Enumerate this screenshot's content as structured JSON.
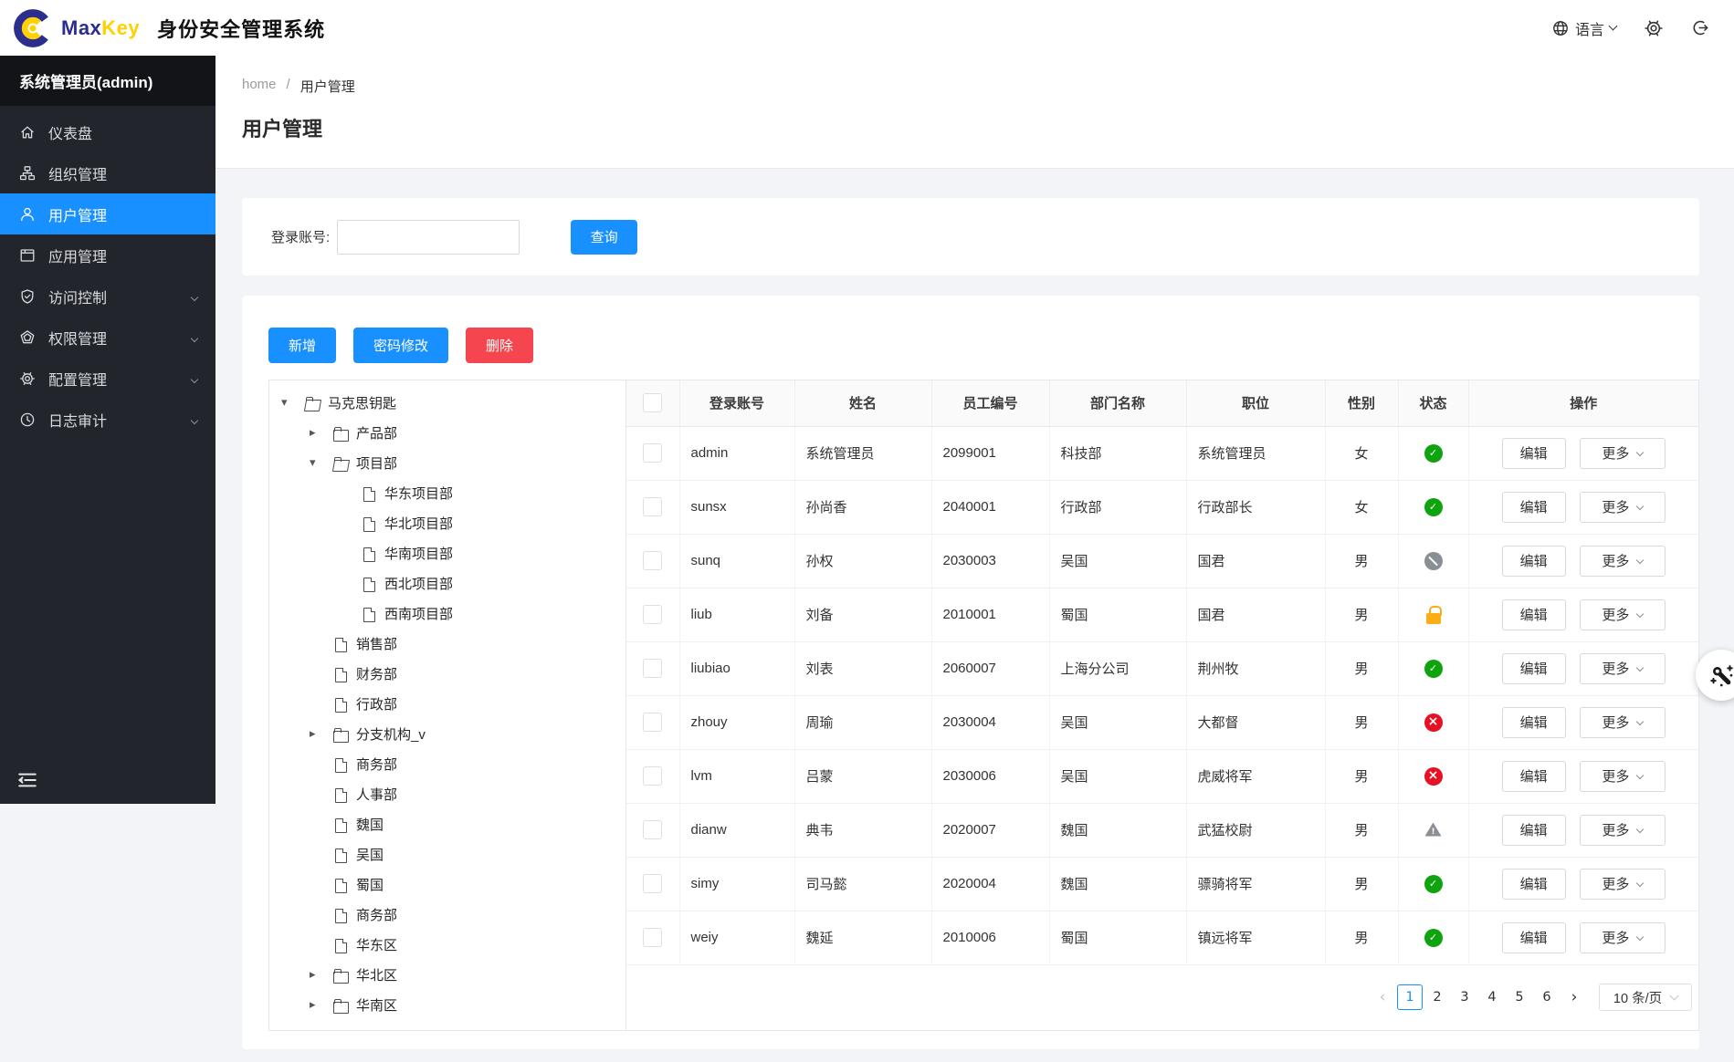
{
  "brand": {
    "name_primary": "Max",
    "name_secondary": "Key",
    "product": "身份安全管理系统"
  },
  "topbar": {
    "language": "语言"
  },
  "sidebar": {
    "user": "系统管理员(admin)",
    "items": [
      {
        "label": "仪表盘",
        "icon": "home-icon"
      },
      {
        "label": "组织管理",
        "icon": "org-icon"
      },
      {
        "label": "用户管理",
        "icon": "user-icon",
        "active": true
      },
      {
        "label": "应用管理",
        "icon": "app-icon"
      },
      {
        "label": "访问控制",
        "icon": "shield-icon",
        "expandable": true
      },
      {
        "label": "权限管理",
        "icon": "gem-icon",
        "expandable": true
      },
      {
        "label": "配置管理",
        "icon": "gear-icon",
        "expandable": true
      },
      {
        "label": "日志审计",
        "icon": "clock-icon",
        "expandable": true
      }
    ]
  },
  "breadcrumb": {
    "home": "home",
    "separator": "/",
    "current": "用户管理"
  },
  "page": {
    "title": "用户管理"
  },
  "search": {
    "label": "登录账号:",
    "value": "",
    "button": "查询"
  },
  "toolbar": {
    "add": "新增",
    "change_password": "密码修改",
    "delete": "删除"
  },
  "tree": {
    "nodes": [
      {
        "label": "马克思钥匙",
        "level": "lvl0",
        "caret": "caret-down",
        "icon": "folder-open"
      },
      {
        "label": "产品部",
        "level": "lvl1",
        "caret": "caret-right",
        "icon": "folder-closed"
      },
      {
        "label": "项目部",
        "level": "lvl1",
        "caret": "caret-down",
        "icon": "folder-open"
      },
      {
        "label": "华东项目部",
        "level": "lvl2",
        "caret": "caret-none",
        "icon": "file"
      },
      {
        "label": "华北项目部",
        "level": "lvl2",
        "caret": "caret-none",
        "icon": "file"
      },
      {
        "label": "华南项目部",
        "level": "lvl2",
        "caret": "caret-none",
        "icon": "file"
      },
      {
        "label": "西北项目部",
        "level": "lvl2",
        "caret": "caret-none",
        "icon": "file"
      },
      {
        "label": "西南项目部",
        "level": "lvl2",
        "caret": "caret-none",
        "icon": "file"
      },
      {
        "label": "销售部",
        "level": "lvl1",
        "caret": "caret-none",
        "icon": "file"
      },
      {
        "label": "财务部",
        "level": "lvl1",
        "caret": "caret-none",
        "icon": "file"
      },
      {
        "label": "行政部",
        "level": "lvl1",
        "caret": "caret-none",
        "icon": "file"
      },
      {
        "label": "分支机构_v",
        "level": "lvl1",
        "caret": "caret-right",
        "icon": "folder-closed"
      },
      {
        "label": "商务部",
        "level": "lvl1",
        "caret": "caret-none",
        "icon": "file"
      },
      {
        "label": "人事部",
        "level": "lvl1",
        "caret": "caret-none",
        "icon": "file"
      },
      {
        "label": "魏国",
        "level": "lvl1",
        "caret": "caret-none",
        "icon": "file"
      },
      {
        "label": "吴国",
        "level": "lvl1",
        "caret": "caret-none",
        "icon": "file"
      },
      {
        "label": "蜀国",
        "level": "lvl1",
        "caret": "caret-none",
        "icon": "file"
      },
      {
        "label": "商务部",
        "level": "lvl1",
        "caret": "caret-none",
        "icon": "file"
      },
      {
        "label": "华东区",
        "level": "lvl1",
        "caret": "caret-none",
        "icon": "file"
      },
      {
        "label": "华北区",
        "level": "lvl1",
        "caret": "caret-right",
        "icon": "folder-closed"
      },
      {
        "label": "华南区",
        "level": "lvl1",
        "caret": "caret-right",
        "icon": "folder-closed"
      }
    ]
  },
  "table": {
    "columns": [
      "登录账号",
      "姓名",
      "员工编号",
      "部门名称",
      "职位",
      "性别",
      "状态",
      "操作"
    ],
    "rows": [
      {
        "account": "admin",
        "name": "系统管理员",
        "employee_id": "2099001",
        "department": "科技部",
        "position": "系统管理员",
        "gender": "女",
        "status": "active"
      },
      {
        "account": "sunsx",
        "name": "孙尚香",
        "employee_id": "2040001",
        "department": "行政部",
        "position": "行政部长",
        "gender": "女",
        "status": "active"
      },
      {
        "account": "sunq",
        "name": "孙权",
        "employee_id": "2030003",
        "department": "吴国",
        "position": "国君",
        "gender": "男",
        "status": "disabled"
      },
      {
        "account": "liub",
        "name": "刘备",
        "employee_id": "2010001",
        "department": "蜀国",
        "position": "国君",
        "gender": "男",
        "status": "locked"
      },
      {
        "account": "liubiao",
        "name": "刘表",
        "employee_id": "2060007",
        "department": "上海分公司",
        "position": "荆州牧",
        "gender": "男",
        "status": "active"
      },
      {
        "account": "zhouy",
        "name": "周瑜",
        "employee_id": "2030004",
        "department": "吴国",
        "position": "大都督",
        "gender": "男",
        "status": "inactive"
      },
      {
        "account": "lvm",
        "name": "吕蒙",
        "employee_id": "2030006",
        "department": "吴国",
        "position": "虎威将军",
        "gender": "男",
        "status": "inactive"
      },
      {
        "account": "dianw",
        "name": "典韦",
        "employee_id": "2020007",
        "department": "魏国",
        "position": "武猛校尉",
        "gender": "男",
        "status": "warning"
      },
      {
        "account": "simy",
        "name": "司马懿",
        "employee_id": "2020004",
        "department": "魏国",
        "position": "骠骑将军",
        "gender": "男",
        "status": "active"
      },
      {
        "account": "weiy",
        "name": "魏延",
        "employee_id": "2010006",
        "department": "蜀国",
        "position": "镇远将军",
        "gender": "男",
        "status": "active"
      }
    ]
  },
  "operations": {
    "edit": "编辑",
    "more": "更多"
  },
  "pagination": {
    "prev": "‹",
    "next": "›",
    "pages": [
      {
        "label": "1",
        "cls": "active"
      },
      {
        "label": "2",
        "cls": ""
      },
      {
        "label": "3",
        "cls": ""
      },
      {
        "label": "4",
        "cls": ""
      },
      {
        "label": "5",
        "cls": ""
      },
      {
        "label": "6",
        "cls": ""
      }
    ],
    "page_size": "10 条/页"
  },
  "colors": {
    "primary": "#1890ff",
    "danger": "#f5454f",
    "success": "#10a310",
    "error": "#e81123",
    "locked": "#faad14",
    "disabled": "#8a8f96",
    "brand_blue": "#2b2e8c",
    "brand_yellow": "#ffd100",
    "sidebar_bg": "#22252c",
    "sidebar_active": "#1890ff"
  }
}
